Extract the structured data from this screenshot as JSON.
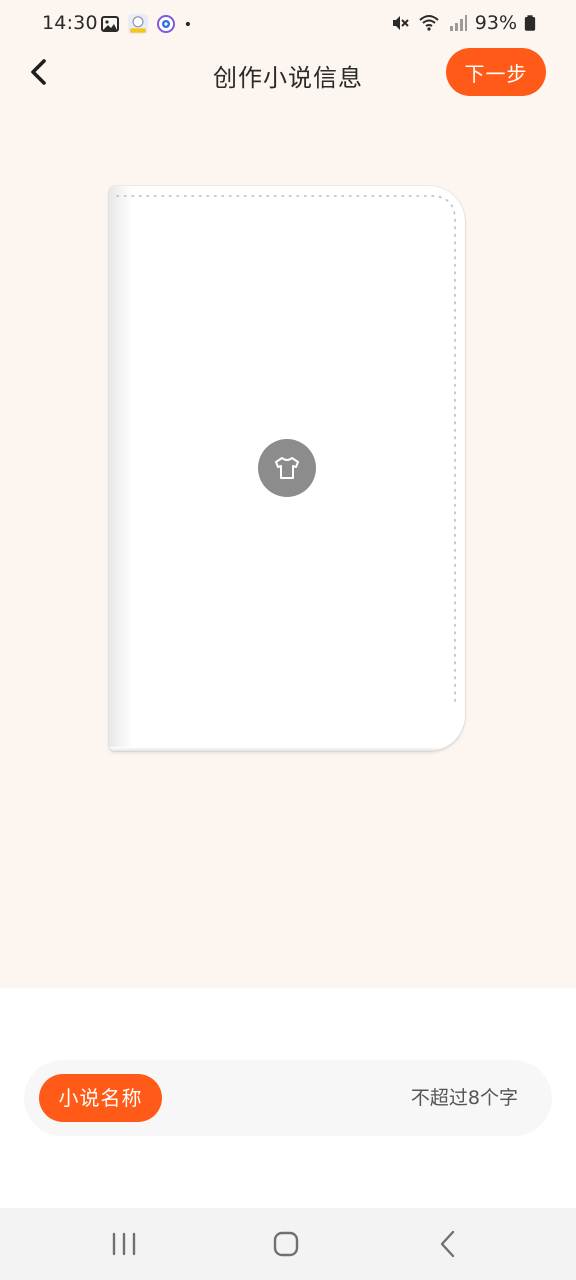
{
  "status_bar": {
    "time": "14:30",
    "battery": "93%",
    "left_icons": [
      "gallery-icon",
      "app-avatar-icon",
      "camera-lens-icon",
      "notification-dot-icon"
    ],
    "right_icons": [
      "mute-icon",
      "wifi-icon",
      "signal-icon",
      "battery-icon"
    ]
  },
  "header": {
    "title": "创作小说信息",
    "next_label": "下一步"
  },
  "cover": {
    "icon": "tshirt-icon"
  },
  "name_field": {
    "label": "小说名称",
    "placeholder": "不超过8个字",
    "value": ""
  },
  "nav_bar": {
    "icons": [
      "recents-icon",
      "home-icon",
      "back-icon"
    ]
  },
  "colors": {
    "accent": "#ff5a17",
    "background": "#fdf5ef",
    "icon_circle": "#8c8c8c"
  }
}
